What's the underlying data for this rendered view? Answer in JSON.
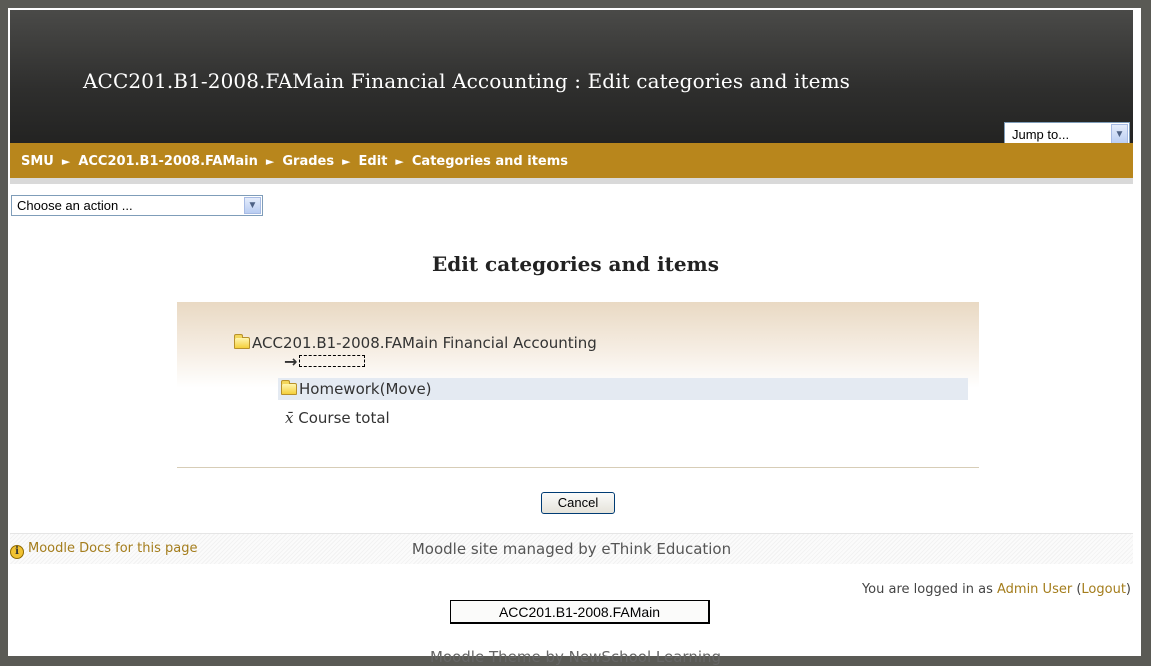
{
  "header": {
    "title": "ACC201.B1-2008.FAMain Financial Accounting : Edit categories and items",
    "jump_label": "Jump to..."
  },
  "breadcrumb": {
    "items": [
      "SMU",
      "ACC201.B1-2008.FAMain",
      "Grades",
      "Edit",
      "Categories and items"
    ],
    "separator": "►"
  },
  "action_select": {
    "value": "Choose an action ..."
  },
  "main": {
    "heading": "Edit categories and items",
    "tree": {
      "root": "ACC201.B1-2008.FAMain Financial Accounting",
      "arrow": "→",
      "homework": "Homework(Move)",
      "xbar": "x̄",
      "course_total": "Course total"
    },
    "cancel_label": "Cancel"
  },
  "footer": {
    "docs_link": "Moodle Docs for this page",
    "managed": "Moodle site managed by eThink Education",
    "login_prefix": "You are logged in as ",
    "user": "Admin User",
    "logout": "Logout",
    "course_button": "ACC201.B1-2008.FAMain",
    "cut_text": "Moodle Theme by NewSchool Learning"
  },
  "colors": {
    "navbar": "#b8861c",
    "link": "#a47d1c",
    "header_bg": "#2e2e2d"
  }
}
